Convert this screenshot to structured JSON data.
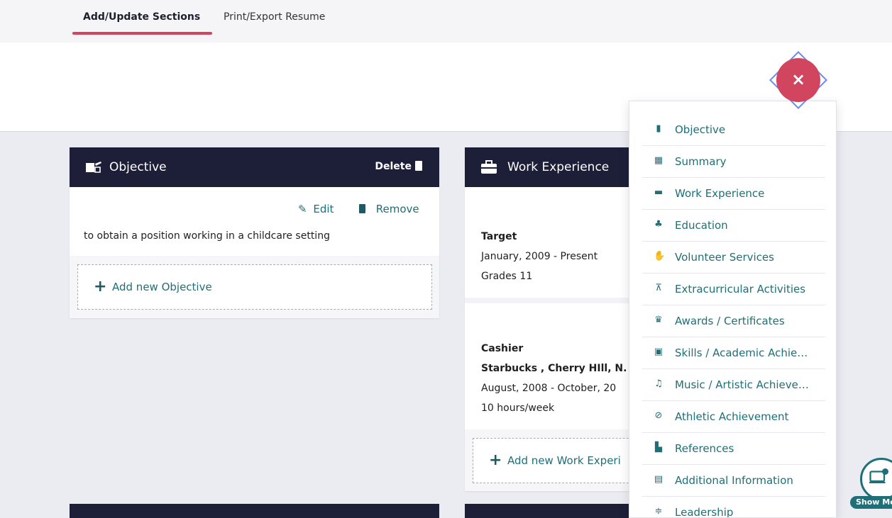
{
  "tabs": [
    {
      "label": "Add/Update Sections",
      "active": true
    },
    {
      "label": "Print/Export Resume",
      "active": false
    }
  ],
  "objective_card": {
    "title": "Objective",
    "delete_label": "Delete",
    "edit_label": "Edit",
    "remove_label": "Remove",
    "text": "to obtain a position working in a childcare setting",
    "add_label": "Add new Objective"
  },
  "work_card": {
    "title": "Work Experience",
    "entries": [
      {
        "company": "Target",
        "dates": "January, 2009 - Present",
        "detail": "Grades 11"
      },
      {
        "position": "Cashier",
        "company": "Starbucks , Cherry HIll, N.",
        "dates": "August, 2008 - October, 20",
        "detail": "10 hours/week"
      }
    ],
    "add_label": "Add new Work Experi"
  },
  "menu": {
    "items": [
      {
        "label": "Objective",
        "icon": "objective-icon"
      },
      {
        "label": "Summary",
        "icon": "summary-icon"
      },
      {
        "label": "Work Experience",
        "icon": "briefcase-icon"
      },
      {
        "label": "Education",
        "icon": "education-icon"
      },
      {
        "label": "Volunteer Services",
        "icon": "hand-icon"
      },
      {
        "label": "Extracurricular Activities",
        "icon": "telescope-icon"
      },
      {
        "label": "Awards / Certificates",
        "icon": "medal-icon"
      },
      {
        "label": "Skills / Academic Achie…",
        "icon": "skills-icon"
      },
      {
        "label": "Music / Artistic Achieve…",
        "icon": "music-file-icon"
      },
      {
        "label": "Athletic Achievement",
        "icon": "football-icon"
      },
      {
        "label": "References",
        "icon": "references-icon"
      },
      {
        "label": "Additional Information",
        "icon": "info-document-icon"
      },
      {
        "label": "Leadership",
        "icon": "leadership-icon"
      }
    ]
  },
  "close_label": "×",
  "show_me_label": "Show Me",
  "colors": {
    "accent": "#d1455f",
    "teal": "#1f6f78",
    "header_dark": "#1d1e38",
    "background_gray": "#ebecf2"
  }
}
